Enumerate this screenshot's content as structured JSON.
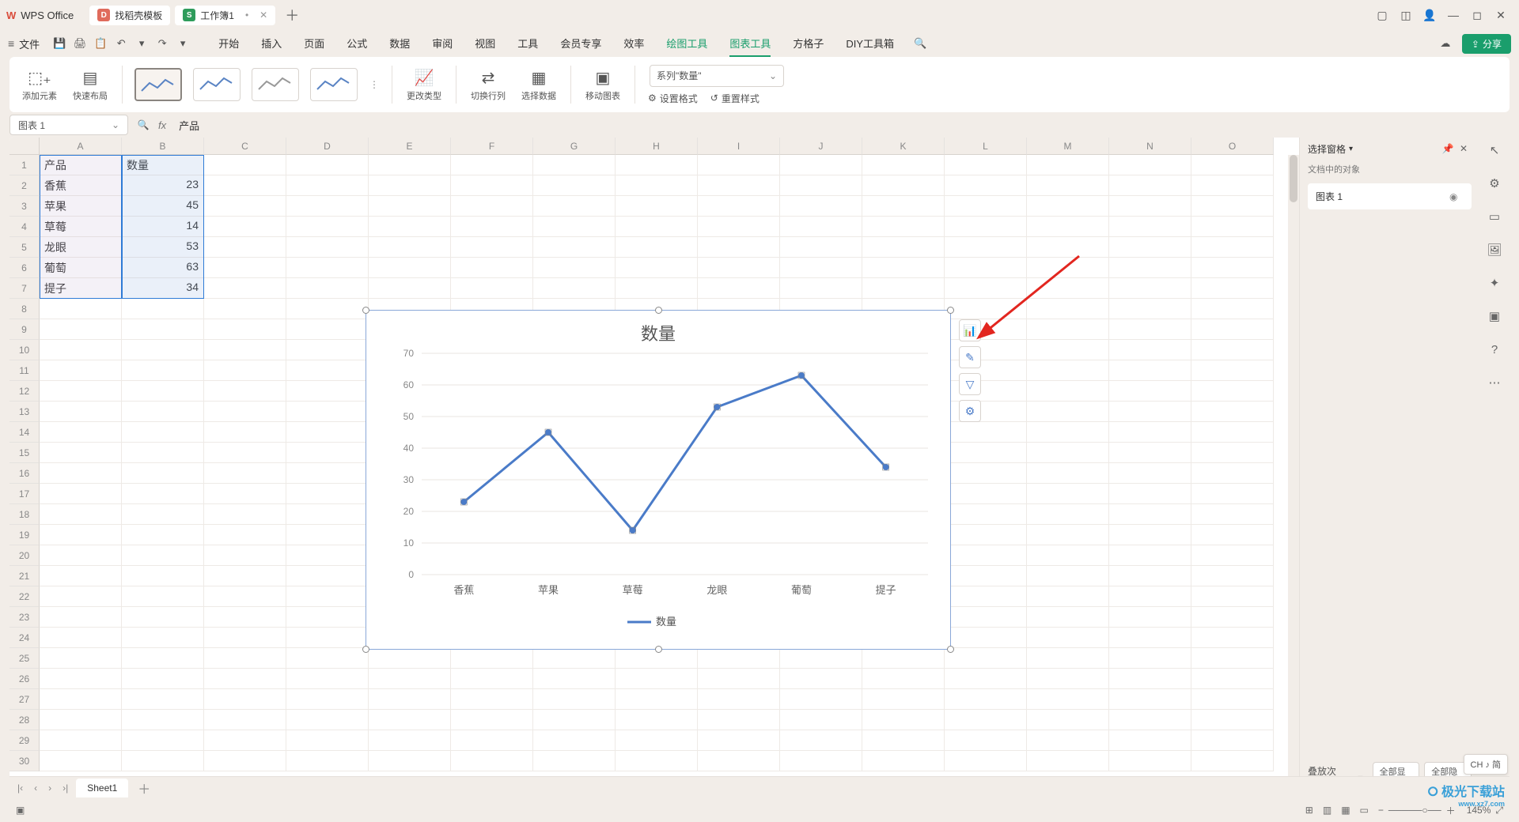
{
  "app": {
    "logo": "W",
    "name": "WPS Office"
  },
  "tabs": {
    "template": "找稻壳模板",
    "doc": "工作簿1",
    "doc_badge": "S",
    "doc_dirty": "•"
  },
  "win": {
    "box": "▢",
    "cube": "◫",
    "user": "👤",
    "min": "—",
    "max": "◻",
    "close": "✕"
  },
  "file": {
    "menuicon": "≡",
    "label": "文件"
  },
  "quick": [
    "💾",
    "🖨",
    "📋",
    "↶",
    "▾",
    "↷",
    "▾"
  ],
  "menutabs": [
    "开始",
    "插入",
    "页面",
    "公式",
    "数据",
    "审阅",
    "视图",
    "工具",
    "会员专享",
    "效率",
    "绘图工具",
    "图表工具",
    "方格子",
    "DIY工具箱"
  ],
  "menutab_green_idx": 10,
  "menutab_active_idx": 11,
  "share": "分享",
  "ribbon": {
    "addel": "添加元素",
    "quicklayout": "快速布局",
    "changetype": "更改类型",
    "swap": "切换行列",
    "seldata": "选择数据",
    "movechart": "移动图表",
    "series_sel": "系列\"数量\"",
    "setfmt": "设置格式",
    "resetstyle": "重置样式"
  },
  "namebox": "图表 1",
  "fxvalue": "产品",
  "columns": [
    "A",
    "B",
    "C",
    "D",
    "E",
    "F",
    "G",
    "H",
    "I",
    "J",
    "K",
    "L",
    "M",
    "N",
    "O"
  ],
  "rows": 30,
  "cells": {
    "A1": "产品",
    "B1": "数量",
    "A2": "香蕉",
    "B2": "23",
    "A3": "苹果",
    "B3": "45",
    "A4": "草莓",
    "B4": "14",
    "A5": "龙眼",
    "B5": "53",
    "A6": "葡萄",
    "B6": "63",
    "A7": "提子",
    "B7": "34"
  },
  "chart_data": {
    "type": "line",
    "title": "数量",
    "categories": [
      "香蕉",
      "苹果",
      "草莓",
      "龙眼",
      "葡萄",
      "提子"
    ],
    "series": [
      {
        "name": "数量",
        "values": [
          23,
          45,
          14,
          53,
          63,
          34
        ]
      }
    ],
    "ylim": [
      0,
      70
    ],
    "ytick": 10,
    "legend": "数量"
  },
  "floatbtns": [
    "📊",
    "✎",
    "▽",
    "⚙"
  ],
  "side": {
    "title": "选择窗格",
    "sub": "文档中的对象",
    "item": "图表 1",
    "stack": "叠放次序",
    "showall": "全部显示",
    "hideall": "全部隐藏"
  },
  "sheet": {
    "name": "Sheet1"
  },
  "status": {
    "zoom": "145%",
    "ime": "CH ♪ 简"
  },
  "watermark": {
    "name": "极光下载站",
    "url": "www.xz7.com"
  }
}
